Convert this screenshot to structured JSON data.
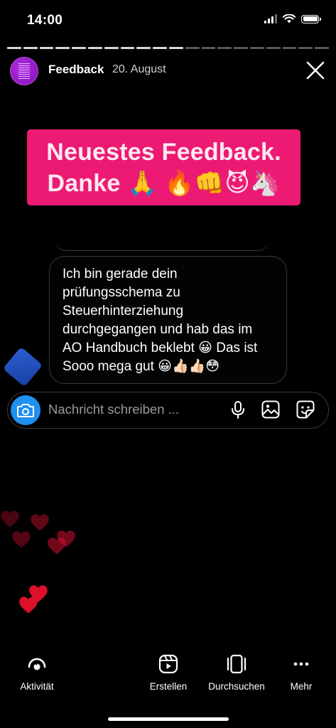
{
  "status_bar": {
    "time": "14:00"
  },
  "story": {
    "progress_total": 20,
    "progress_done": 11
  },
  "header": {
    "name": "Feedback",
    "date": "20. August"
  },
  "sticker": {
    "line1": "Neuestes Feedback.",
    "line2": "Danke 🙏 🔥👊😈🦄"
  },
  "message": {
    "lines": [
      "Ich bin gerade dein",
      "prüfungsschema zu",
      "Steuerhinterziehung",
      "durchgegangen und hab das im",
      "AO Handbuch beklebt 😀  Das ist",
      "Sooo mega gut 😀👍🏻👍🏻😳"
    ]
  },
  "composer": {
    "placeholder": "Nachricht schreiben ..."
  },
  "nav": {
    "activity": "Aktivität",
    "create": "Erstellen",
    "browse": "Durchsuchen",
    "more": "Mehr"
  },
  "colors": {
    "sticker_bg": "#ec1a72",
    "camera_button": "#1f90f0",
    "heart": "#d11030"
  }
}
